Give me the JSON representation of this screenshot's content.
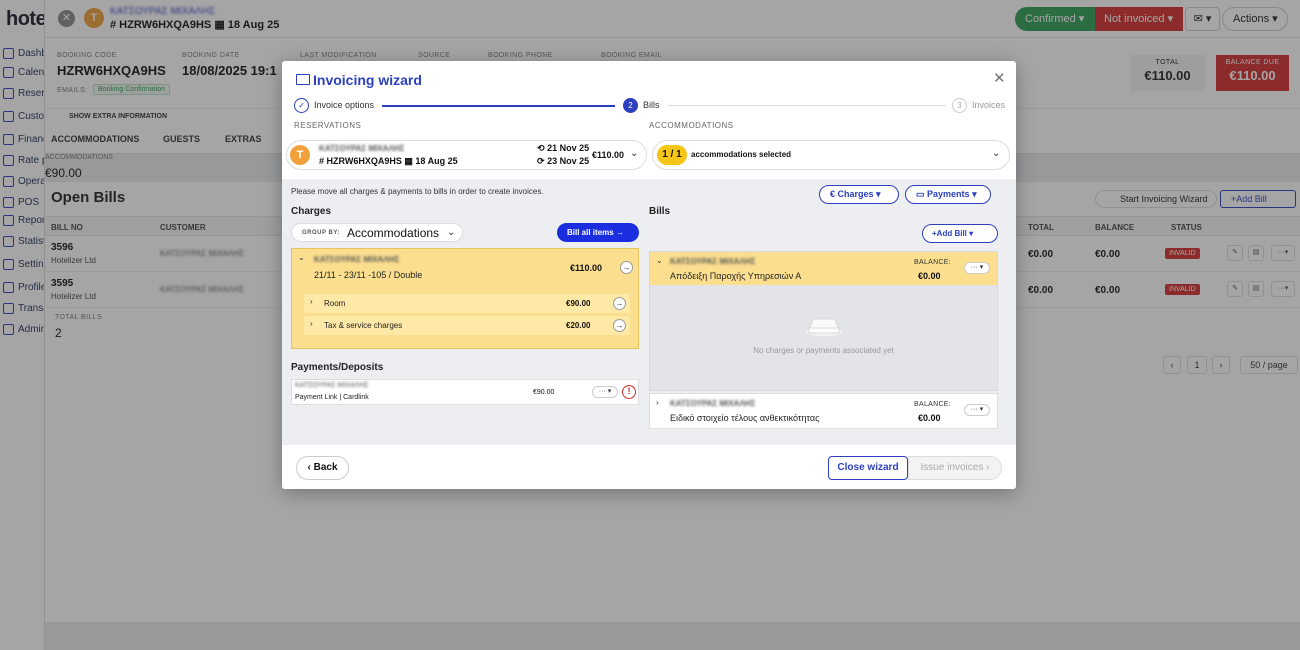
{
  "app": {
    "logo": "hote"
  },
  "sidebar": {
    "items": [
      "Dashboard",
      "Calendar",
      "Reservations",
      "Customers",
      "Finance",
      "Rate plans",
      "Operations",
      "POS",
      "Reports",
      "Statistics",
      "Settings",
      "Profile",
      "Transactions",
      "Admin"
    ]
  },
  "topbar": {
    "avatar_letter": "T",
    "guest_name": "ΚΑΤΣΟΥΡΑΣ ΜΙΧΑΛΗΣ",
    "code_line": "# HZRW6HXQA9HS",
    "date": "18 Aug 25",
    "status_confirmed": "Confirmed",
    "status_invoice": "Not invoiced",
    "actions": "Actions"
  },
  "booking": {
    "code_label": "BOOKING CODE",
    "code": "HZRW6HXQA9HS",
    "date_label": "BOOKING DATE",
    "date": "18/08/2025 19:1",
    "lastmod_label": "LAST MODIFICATION",
    "source_label": "SOURCE",
    "phone_label": "BOOKING PHONE",
    "email_label": "BOOKING EMAIL",
    "emails_label": "EMAILS:",
    "emails_badge": "Booking Confirmation",
    "total_label": "TOTAL",
    "total": "€110.00",
    "due_label": "BALANCE DUE",
    "due": "€110.00",
    "extra": "SHOW EXTRA INFORMATION"
  },
  "tabs": [
    "ACCOMMODATIONS",
    "GUESTS",
    "EXTRAS"
  ],
  "acc_summary": {
    "label": "ACCOMMODATIONS",
    "value": "€90.00"
  },
  "openbills": {
    "title": "Open Bills",
    "start_wizard": "Start Invoicing Wizard",
    "add_bill": "+Add Bill",
    "columns": [
      "BILL NO",
      "CUSTOMER",
      "TOTAL",
      "BALANCE",
      "STATUS"
    ],
    "rows": [
      {
        "no": "3596",
        "company": "Hotelizer Ltd",
        "customer": "ΚΑΤΣΟΥΡΑΣ ΜΙΧΑΛΗΣ",
        "total": "€0.00",
        "balance": "€0.00",
        "status": "INVALID"
      },
      {
        "no": "3595",
        "company": "Hotelizer Ltd",
        "customer": "ΚΑΤΣΟΥΡΑΣ ΜΙΧΑΛΗΣ",
        "total": "€0.00",
        "balance": "€0.00",
        "status": "INVALID"
      }
    ],
    "total_bills_label": "TOTAL BILLS",
    "total_bills": "2",
    "page": "1",
    "per_page": "50 / page"
  },
  "wizard": {
    "title": "Invoicing wizard",
    "steps": [
      {
        "num": "✓",
        "label": "Invoice options"
      },
      {
        "num": "2",
        "label": "Bills"
      },
      {
        "num": "3",
        "label": "Invoices"
      }
    ],
    "reservations_label": "RESERVATIONS",
    "accommodations_label": "ACCOMMODATIONS",
    "reservation": {
      "avatar": "T",
      "name": "ΚΑΤΣΟΥΡΑΣ ΜΙΧΑΛΗΣ",
      "code": "# HZRW6HXQA9HS",
      "date": "18 Aug 25",
      "checkin": "21 Nov 25",
      "checkout": "23 Nov 25",
      "amount": "€110.00"
    },
    "acc_selected": {
      "count": "1 / 1",
      "text": "accommodations selected"
    },
    "hint": "Please move all charges & payments to bills in order to create invoices.",
    "charges_btn": "Charges",
    "payments_btn": "Payments",
    "charges_title": "Charges",
    "bills_title": "Bills",
    "group_by_label": "GROUP BY:",
    "group_by_value": "Accommodations",
    "bill_all": "Bill all items",
    "charge_group": {
      "name": "ΚΑΤΣΟΥΡΑΣ ΜΙΧΑΛΗΣ",
      "sub": "21/11 - 23/11 -105 / Double",
      "amount": "€110.00"
    },
    "sub_charges": [
      {
        "label": "Room",
        "amount": "€90.00"
      },
      {
        "label": "Tax & service charges",
        "amount": "€20.00"
      }
    ],
    "payments_title": "Payments/Deposits",
    "payment": {
      "name": "ΚΑΤΣΟΥΡΑΣ ΜΙΧΑΛΗΣ",
      "sub": "Payment Link | Cardlink",
      "amount": "€90.00"
    },
    "add_bill": "+Add Bill",
    "bills": [
      {
        "name": "ΚΑΤΣΟΥΡΑΣ ΜΙΧΑΛΗΣ",
        "type": "Απόδειξη Παροχής Υπηρεσιών Α",
        "balance_label": "BALANCE:",
        "balance": "€0.00"
      },
      {
        "name": "ΚΑΤΣΟΥΡΑΣ ΜΙΧΑΛΗΣ",
        "type": "Ειδικό στοιχείο τέλους ανθεκτικότητας",
        "balance_label": "BALANCE:",
        "balance": "€0.00"
      }
    ],
    "empty_text": "No charges or payments associated yet",
    "back": "Back",
    "close": "Close wizard",
    "issue": "Issue invoices"
  },
  "colors": {
    "accent": "#2b3fbf",
    "confirmed": "#2f9e56",
    "danger": "#d22d2d",
    "highlight": "#fbdf8f"
  }
}
